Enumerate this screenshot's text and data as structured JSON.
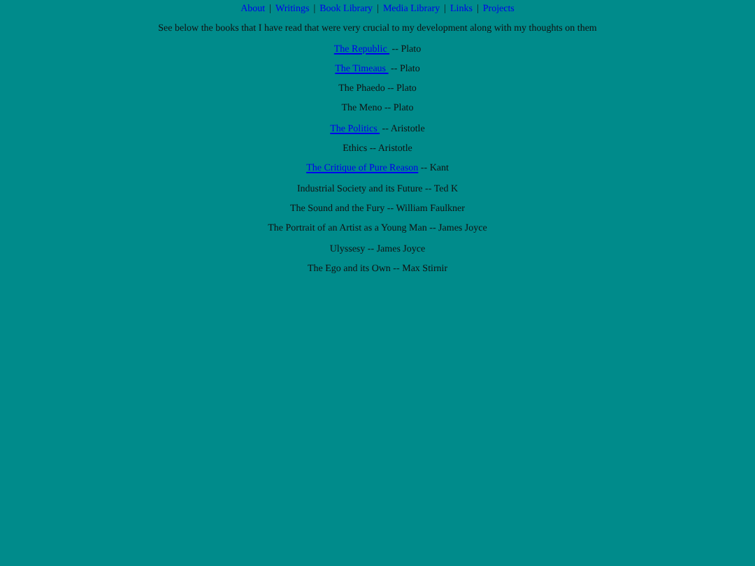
{
  "nav": {
    "separator": "|",
    "links": [
      "About",
      "Writings",
      "Book Library",
      "Media Library",
      "Links",
      "Projects"
    ]
  },
  "intro": "See below the books that I have read that were very crucial to my development along with my thoughts on them",
  "books": [
    {
      "title": "The Republic ",
      "byline": "-- Plato",
      "linked": true
    },
    {
      "title": "The Timeaus ",
      "byline": "-- Plato",
      "linked": true
    },
    {
      "title": "The Phaedo",
      "byline": "-- Plato",
      "linked": false
    },
    {
      "title": "The Meno",
      "byline": "-- Plato",
      "linked": false
    },
    {
      "title": "The Politics ",
      "byline": "-- Aristotle",
      "linked": true
    },
    {
      "title": "Ethics",
      "byline": "-- Aristotle",
      "linked": false
    },
    {
      "title": "The Critique of Pure Reason",
      "byline": "-- Kant",
      "linked": true
    },
    {
      "title": "Industrial Society and its Future",
      "byline": "-- Ted K",
      "linked": false
    },
    {
      "title": "The Sound and the Fury",
      "byline": "-- William Faulkner",
      "linked": false
    },
    {
      "title": "The Portrait of an Artist as a Young Man",
      "byline": "-- James Joyce",
      "linked": false
    },
    {
      "title": "Ulyssesy",
      "byline": "-- James Joyce",
      "linked": false
    },
    {
      "title": "The Ego and its Own",
      "byline": "-- Max Stirnir",
      "linked": false
    }
  ]
}
